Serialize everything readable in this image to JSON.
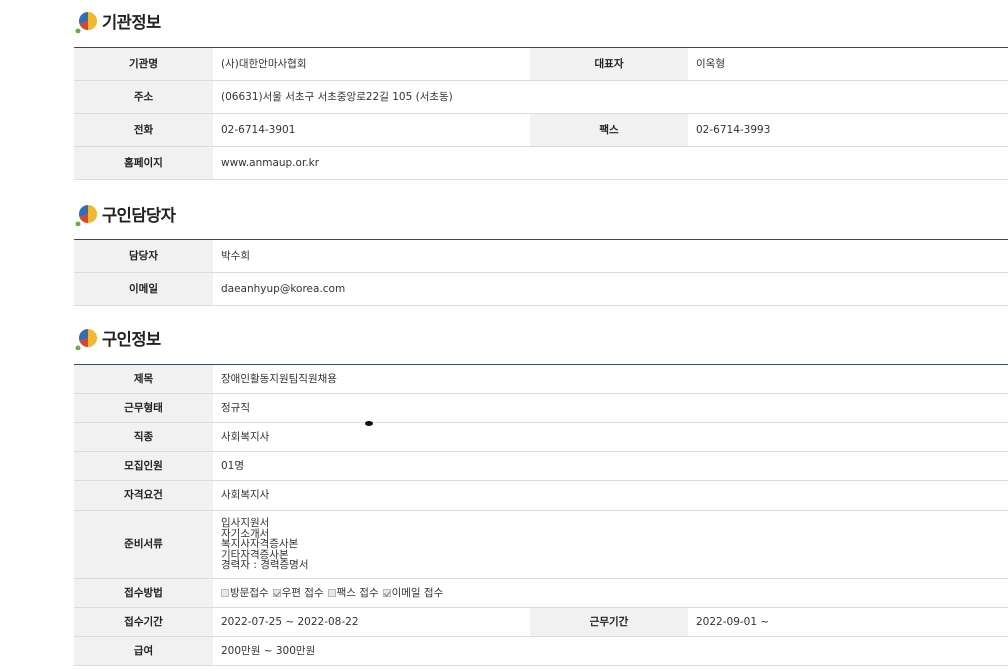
{
  "org_section": {
    "title": "기관정보",
    "rows": {
      "name_label": "기관명",
      "name": "(사)대한안마사협회",
      "rep_label": "대표자",
      "rep": "이옥형",
      "addr_label": "주소",
      "addr": "(06631)서울 서초구 서초중앙로22길 105 (서초동)",
      "tel_label": "전화",
      "tel": "02-6714-3901",
      "fax_label": "팩스",
      "fax": "02-6714-3993",
      "home_label": "홈페이지",
      "home": "www.anmaup.or.kr"
    }
  },
  "contact_section": {
    "title": "구인담당자",
    "person_label": "담당자",
    "person": "박수희",
    "email_label": "이메일",
    "email": "daeanhyup@korea.com"
  },
  "job_section": {
    "title": "구인정보",
    "subject_label": "제목",
    "subject": "장애인활동지원팀직원채용",
    "worktype_label": "근무형태",
    "worktype": "정규직",
    "occupation_label": "직종",
    "occupation": "사회복지사",
    "headcount_label": "모집인원",
    "headcount": "01명",
    "qual_label": "자격요건",
    "qual": "사회복지사",
    "docs_label": "준비서류",
    "docs": [
      "입사지원서",
      "자기소개서",
      "복지사자격증사본",
      "기타자격증사본",
      "경력자 : 경력증명서"
    ],
    "method_label": "접수방법",
    "methods": [
      {
        "label": "방문접수",
        "checked": false
      },
      {
        "label": "우편 접수",
        "checked": true
      },
      {
        "label": "팩스 접수",
        "checked": false
      },
      {
        "label": "이메일 접수",
        "checked": true
      }
    ],
    "period_label": "접수기간",
    "period": "2022-07-25 ~ 2022-08-22",
    "workperiod_label": "근무기간",
    "workperiod": "2022-09-01 ~",
    "salary_label": "급여",
    "salary": "200만원 ~ 300만원"
  }
}
